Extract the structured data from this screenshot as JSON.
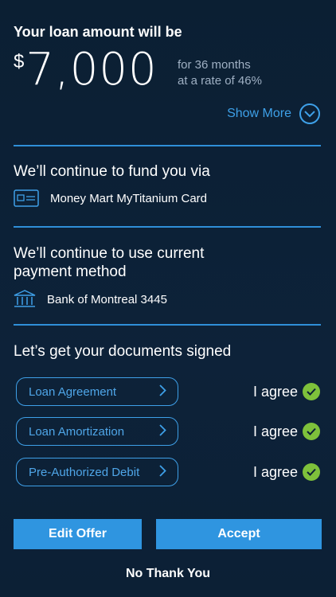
{
  "offer": {
    "title": "Your loan amount will be",
    "currency_symbol": "$",
    "amount": "7,000",
    "term_line1": "for 36 months",
    "term_line2": "at a rate of 46%",
    "show_more_label": "Show More"
  },
  "funding": {
    "title": "We’ll continue to fund you via",
    "method_label": "Money Mart MyTitanium Card",
    "icon": "card-icon"
  },
  "payment": {
    "title_line1": "We’ll continue to use current",
    "title_line2": "payment method",
    "method_label": "Bank of Montreal 3445",
    "icon": "bank-icon"
  },
  "documents": {
    "title": "Let’s get your documents signed",
    "items": [
      {
        "label": "Loan Agreement",
        "status": "I agree"
      },
      {
        "label": "Loan Amortization",
        "status": "I agree"
      },
      {
        "label": "Pre-Authorized Debit",
        "status": "I agree"
      }
    ]
  },
  "actions": {
    "edit_label": "Edit Offer",
    "accept_label": "Accept",
    "decline_label": "No Thank You"
  },
  "colors": {
    "accent": "#2f95e0",
    "check": "#7ec13b",
    "background": "#0c2035"
  }
}
